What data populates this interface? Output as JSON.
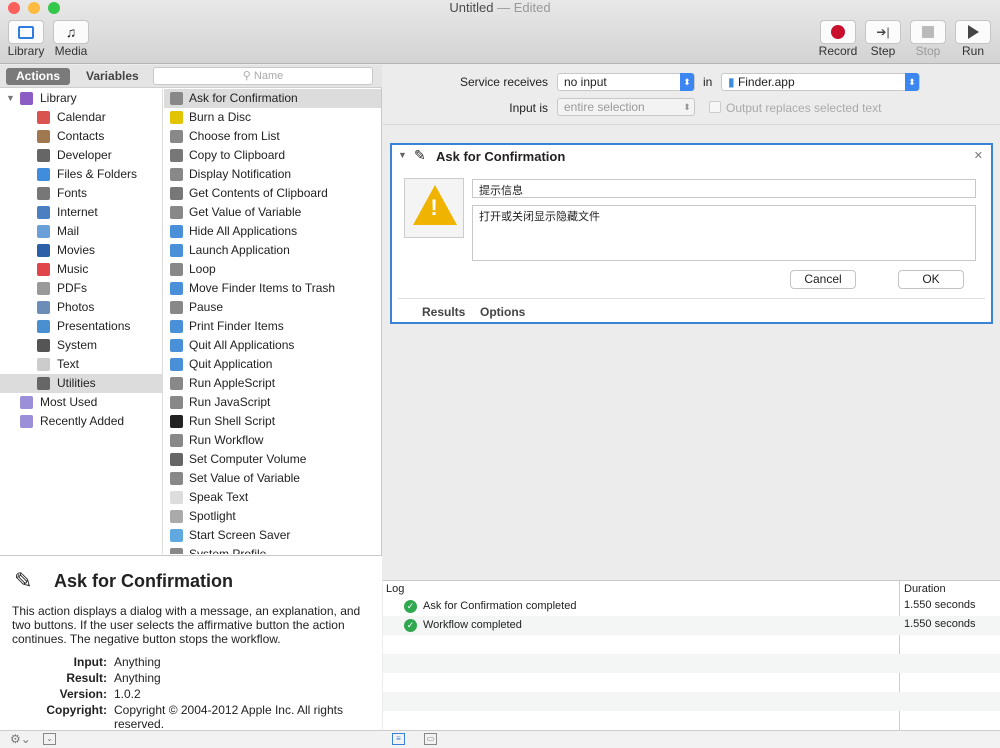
{
  "window": {
    "title": "Untitled",
    "title_sep": " — ",
    "status": "Edited"
  },
  "toolbar": {
    "library": "Library",
    "media": "Media",
    "record": "Record",
    "step": "Step",
    "stop": "Stop",
    "run": "Run"
  },
  "tabs": {
    "actions": "Actions",
    "variables": "Variables"
  },
  "search": {
    "placeholder": "Name"
  },
  "library": [
    {
      "label": "Library",
      "icon": "library-icon",
      "color": "#8a5cc4",
      "indent": 0
    },
    {
      "label": "Calendar",
      "icon": "calendar-icon",
      "color": "#d9534f",
      "indent": 1
    },
    {
      "label": "Contacts",
      "icon": "contacts-icon",
      "color": "#a07850",
      "indent": 1
    },
    {
      "label": "Developer",
      "icon": "developer-icon",
      "color": "#666",
      "indent": 1
    },
    {
      "label": "Files & Folders",
      "icon": "finder-icon",
      "color": "#3f8ddc",
      "indent": 1
    },
    {
      "label": "Fonts",
      "icon": "fonts-icon",
      "color": "#777",
      "indent": 1
    },
    {
      "label": "Internet",
      "icon": "internet-icon",
      "color": "#4a7fc1",
      "indent": 1
    },
    {
      "label": "Mail",
      "icon": "mail-icon",
      "color": "#6aa0d8",
      "indent": 1
    },
    {
      "label": "Movies",
      "icon": "movies-icon",
      "color": "#2b5fa8",
      "indent": 1
    },
    {
      "label": "Music",
      "icon": "music-icon",
      "color": "#e0454a",
      "indent": 1
    },
    {
      "label": "PDFs",
      "icon": "pdf-icon",
      "color": "#999",
      "indent": 1
    },
    {
      "label": "Photos",
      "icon": "photos-icon",
      "color": "#6b8db8",
      "indent": 1
    },
    {
      "label": "Presentations",
      "icon": "presentations-icon",
      "color": "#4a90d0",
      "indent": 1
    },
    {
      "label": "System",
      "icon": "system-icon",
      "color": "#555",
      "indent": 1
    },
    {
      "label": "Text",
      "icon": "text-icon",
      "color": "#ccc",
      "indent": 1
    },
    {
      "label": "Utilities",
      "icon": "utilities-icon",
      "color": "#666",
      "indent": 1,
      "selected": true
    },
    {
      "label": "Most Used",
      "icon": "smart-folder-icon",
      "color": "#9b8fd8",
      "indent": 0
    },
    {
      "label": "Recently Added",
      "icon": "smart-folder-icon",
      "color": "#9b8fd8",
      "indent": 0
    }
  ],
  "actions": [
    {
      "label": "Ask for Confirmation",
      "icon": "automator-icon",
      "selected": true
    },
    {
      "label": "Burn a Disc",
      "icon": "burn-icon"
    },
    {
      "label": "Choose from List",
      "icon": "automator-icon"
    },
    {
      "label": "Copy to Clipboard",
      "icon": "scissors-icon"
    },
    {
      "label": "Display Notification",
      "icon": "automator-icon"
    },
    {
      "label": "Get Contents of Clipboard",
      "icon": "scissors-icon"
    },
    {
      "label": "Get Value of Variable",
      "icon": "automator-icon"
    },
    {
      "label": "Hide All Applications",
      "icon": "finder-icon"
    },
    {
      "label": "Launch Application",
      "icon": "finder-icon"
    },
    {
      "label": "Loop",
      "icon": "automator-icon"
    },
    {
      "label": "Move Finder Items to Trash",
      "icon": "finder-icon"
    },
    {
      "label": "Pause",
      "icon": "automator-icon"
    },
    {
      "label": "Print Finder Items",
      "icon": "finder-icon"
    },
    {
      "label": "Quit All Applications",
      "icon": "finder-icon"
    },
    {
      "label": "Quit Application",
      "icon": "finder-icon"
    },
    {
      "label": "Run AppleScript",
      "icon": "automator-icon"
    },
    {
      "label": "Run JavaScript",
      "icon": "automator-icon"
    },
    {
      "label": "Run Shell Script",
      "icon": "terminal-icon"
    },
    {
      "label": "Run Workflow",
      "icon": "automator-icon"
    },
    {
      "label": "Set Computer Volume",
      "icon": "volume-icon"
    },
    {
      "label": "Set Value of Variable",
      "icon": "automator-icon"
    },
    {
      "label": "Speak Text",
      "icon": "text-icon"
    },
    {
      "label": "Spotlight",
      "icon": "spotlight-icon"
    },
    {
      "label": "Start Screen Saver",
      "icon": "screensaver-icon"
    },
    {
      "label": "System Profile",
      "icon": "automator-icon"
    }
  ],
  "description": {
    "title": "Ask for Confirmation",
    "text": "This action displays a dialog with a message, an explanation, and two buttons. If the user selects the affirmative button the action continues. The negative button stops the workflow.",
    "fields": [
      {
        "k": "Input:",
        "v": "Anything"
      },
      {
        "k": "Result:",
        "v": "Anything"
      },
      {
        "k": "Version:",
        "v": "1.0.2"
      },
      {
        "k": "Copyright:",
        "v": "Copyright © 2004-2012 Apple Inc.  All rights reserved."
      }
    ]
  },
  "service": {
    "receives_label": "Service receives",
    "receives_value": "no input",
    "in_label": "in",
    "app": "Finder.app",
    "input_is_label": "Input is",
    "input_is_value": "entire selection",
    "output_replaces": "Output replaces selected text"
  },
  "card": {
    "title": "Ask for Confirmation",
    "message": "提示信息",
    "explanation": "打开或关闭显示隐藏文件",
    "cancel": "Cancel",
    "ok": "OK",
    "tab_results": "Results",
    "tab_options": "Options"
  },
  "log": {
    "col_log": "Log",
    "col_duration": "Duration",
    "rows": [
      {
        "text": "Ask for Confirmation completed",
        "duration": "1.550 seconds"
      },
      {
        "text": "Workflow completed",
        "duration": "1.550 seconds"
      }
    ]
  },
  "colors": {
    "accent": "#3a82d6",
    "record": "#c8102e",
    "success": "#2fa84f"
  }
}
